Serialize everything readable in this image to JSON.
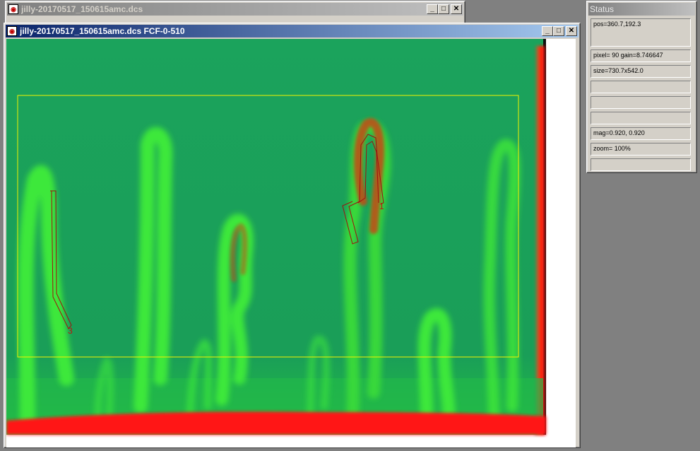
{
  "back_window": {
    "title": "jilly-20170517_150615amc.dcs"
  },
  "main_window": {
    "title": "jilly-20170517_150615amc.dcs FCF-0-510"
  },
  "window_buttons": {
    "minimize": "_",
    "maximize": "□",
    "close": "✕"
  },
  "image_view": {
    "icon": "image-icon",
    "roi_labels": [
      "3",
      "1"
    ],
    "colors": {
      "background": "#1aa35a",
      "plume": "#39e53a",
      "hot": "#ff1010",
      "roi_box": "#f2f200",
      "roi_outline": "#a01010"
    }
  },
  "status_window": {
    "title": "Status",
    "fields": [
      "pos=360.7,192.3",
      "pixel= 90 gain=8.746647",
      "size=730.7x542.0",
      "",
      "",
      "",
      "mag=0.920, 0.920",
      "zoom= 100%",
      ""
    ]
  }
}
